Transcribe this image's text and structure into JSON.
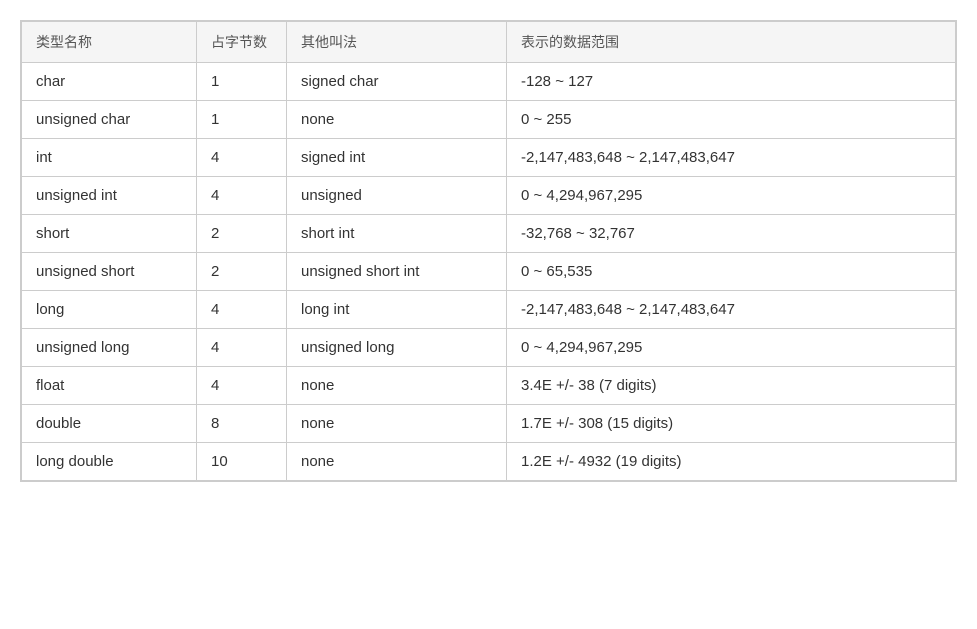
{
  "table": {
    "headers": [
      "类型名称",
      "占字节数",
      "其他叫法",
      "表示的数据范围"
    ],
    "rows": [
      {
        "name": "char",
        "bytes": "1",
        "alias": "signed char",
        "range": "-128 ~ 127"
      },
      {
        "name": "unsigned char",
        "bytes": "1",
        "alias": "none",
        "range": "0 ~ 255"
      },
      {
        "name": "int",
        "bytes": "4",
        "alias": "signed int",
        "range": "-2,147,483,648 ~ 2,147,483,647"
      },
      {
        "name": "unsigned int",
        "bytes": "4",
        "alias": "unsigned",
        "range": "0 ~ 4,294,967,295"
      },
      {
        "name": "short",
        "bytes": "2",
        "alias": "short int",
        "range": "-32,768 ~ 32,767"
      },
      {
        "name": "unsigned short",
        "bytes": "2",
        "alias": "unsigned short int",
        "range": "0 ~ 65,535"
      },
      {
        "name": "long",
        "bytes": "4",
        "alias": "long int",
        "range": "-2,147,483,648 ~ 2,147,483,647"
      },
      {
        "name": "unsigned long",
        "bytes": "4",
        "alias": "unsigned long",
        "range": "0 ~ 4,294,967,295"
      },
      {
        "name": "float",
        "bytes": "4",
        "alias": "none",
        "range": "3.4E +/- 38 (7 digits)"
      },
      {
        "name": "double",
        "bytes": "8",
        "alias": "none",
        "range": "1.7E +/- 308 (15 digits)"
      },
      {
        "name": "long double",
        "bytes": "10",
        "alias": "none",
        "range": "1.2E +/- 4932 (19 digits)"
      }
    ]
  }
}
